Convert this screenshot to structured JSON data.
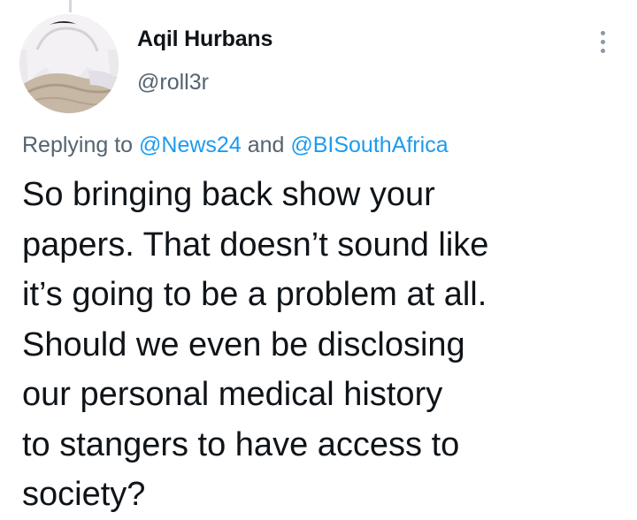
{
  "tweet": {
    "author": {
      "display_name": "Aqil Hurbans",
      "handle": "@roll3r"
    },
    "reply_context": {
      "prefix": "Replying to",
      "mention_1": "@News24",
      "joiner": "and",
      "mention_2": "@BISouthAfrica"
    },
    "text_lines": [
      "So bringing back show your",
      "papers. That doesn’t sound like",
      "it’s going to be a problem at all.",
      "Should we even be disclosing",
      "our personal medical history",
      "to stangers to have access to",
      "society?"
    ]
  },
  "icons": {
    "more": "more-vertical-icon"
  },
  "colors": {
    "primary_text": "#0f1419",
    "secondary_text": "#536471",
    "link": "#1d9bf0",
    "icon": "#8a98a5",
    "thread_line": "#cfd9de"
  }
}
